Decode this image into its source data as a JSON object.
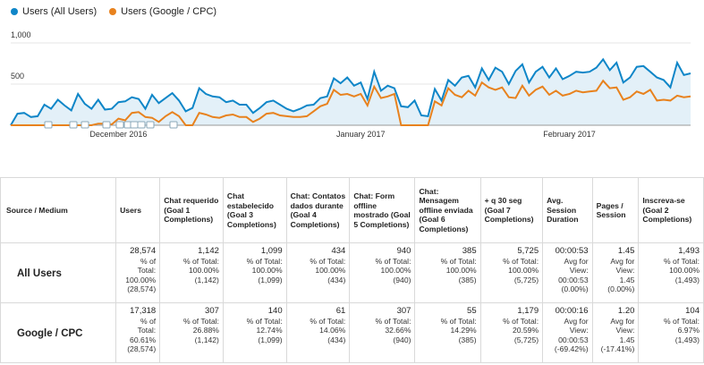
{
  "colors": {
    "all_users": "#0f86c8",
    "google_cpc": "#e8821e",
    "area_fill": "#e3f0f8",
    "grid": "#e5e5e5"
  },
  "legend": [
    {
      "label": "Users (All Users)",
      "color": "#0f86c8"
    },
    {
      "label": "Users (Google / CPC)",
      "color": "#e8821e"
    }
  ],
  "chart_data": {
    "type": "line",
    "ylim": [
      0,
      1000
    ],
    "yticks": [
      "1,000",
      "500"
    ],
    "x_labels": [
      "December 2016",
      "January 2017",
      "February 2017"
    ],
    "x": [
      "2016-11-19",
      "2016-11-20",
      "2016-11-21",
      "2016-11-22",
      "2016-11-23",
      "2016-11-24",
      "2016-11-25",
      "2016-11-26",
      "2016-11-27",
      "2016-11-28",
      "2016-11-29",
      "2016-11-30",
      "2016-12-01",
      "2016-12-02",
      "2016-12-03",
      "2016-12-04",
      "2016-12-05",
      "2016-12-06",
      "2016-12-07",
      "2016-12-08",
      "2016-12-09",
      "2016-12-10",
      "2016-12-11",
      "2016-12-12",
      "2016-12-13",
      "2016-12-14",
      "2016-12-15",
      "2016-12-16",
      "2016-12-17",
      "2016-12-18",
      "2016-12-19",
      "2016-12-20",
      "2016-12-21",
      "2016-12-22",
      "2016-12-23",
      "2016-12-24",
      "2016-12-25",
      "2016-12-26",
      "2016-12-27",
      "2016-12-28",
      "2016-12-29",
      "2016-12-30",
      "2016-12-31",
      "2017-01-01",
      "2017-01-02",
      "2017-01-03",
      "2017-01-04",
      "2017-01-05",
      "2017-01-06",
      "2017-01-07",
      "2017-01-08",
      "2017-01-09",
      "2017-01-10",
      "2017-01-11",
      "2017-01-12",
      "2017-01-13",
      "2017-01-14",
      "2017-01-15",
      "2017-01-16",
      "2017-01-17",
      "2017-01-18",
      "2017-01-19",
      "2017-01-20",
      "2017-01-21",
      "2017-01-22",
      "2017-01-23",
      "2017-01-24",
      "2017-01-25",
      "2017-01-26",
      "2017-01-27",
      "2017-01-28",
      "2017-01-29",
      "2017-01-30",
      "2017-01-31",
      "2017-02-01",
      "2017-02-02",
      "2017-02-03",
      "2017-02-04",
      "2017-02-05",
      "2017-02-06",
      "2017-02-07",
      "2017-02-08",
      "2017-02-09",
      "2017-02-10",
      "2017-02-11",
      "2017-02-12",
      "2017-02-13",
      "2017-02-14",
      "2017-02-15",
      "2017-02-16",
      "2017-02-17",
      "2017-02-18",
      "2017-02-19",
      "2017-02-20",
      "2017-02-21",
      "2017-02-22",
      "2017-02-23",
      "2017-02-24",
      "2017-02-25",
      "2017-02-26",
      "2017-02-27",
      "2017-02-28"
    ],
    "series": [
      {
        "name": "Users (All Users)",
        "values": [
          0,
          140,
          150,
          100,
          110,
          250,
          200,
          310,
          240,
          180,
          380,
          260,
          200,
          310,
          190,
          200,
          280,
          290,
          340,
          320,
          200,
          370,
          270,
          330,
          390,
          300,
          170,
          210,
          450,
          380,
          350,
          340,
          280,
          300,
          250,
          250,
          150,
          210,
          280,
          300,
          250,
          200,
          170,
          200,
          240,
          250,
          330,
          350,
          570,
          510,
          580,
          480,
          520,
          320,
          650,
          420,
          480,
          450,
          230,
          220,
          300,
          120,
          110,
          440,
          300,
          550,
          480,
          580,
          600,
          460,
          690,
          550,
          700,
          650,
          500,
          660,
          740,
          520,
          650,
          710,
          580,
          690,
          560,
          600,
          650,
          640,
          650,
          700,
          800,
          670,
          760,
          520,
          580,
          710,
          720,
          650,
          580,
          550,
          460,
          760,
          610,
          630
        ]
      },
      {
        "name": "Users (Google / CPC)",
        "values": [
          0,
          0,
          0,
          0,
          0,
          0,
          0,
          0,
          0,
          0,
          0,
          0,
          0,
          20,
          20,
          10,
          80,
          60,
          150,
          160,
          100,
          90,
          40,
          110,
          160,
          110,
          0,
          0,
          150,
          130,
          100,
          90,
          120,
          130,
          100,
          100,
          40,
          80,
          140,
          150,
          120,
          110,
          100,
          100,
          110,
          170,
          230,
          260,
          430,
          370,
          380,
          350,
          380,
          240,
          470,
          330,
          350,
          380,
          0,
          0,
          0,
          0,
          0,
          290,
          240,
          450,
          370,
          340,
          420,
          360,
          520,
          460,
          430,
          460,
          340,
          330,
          480,
          360,
          430,
          470,
          370,
          420,
          360,
          380,
          420,
          400,
          410,
          420,
          540,
          450,
          460,
          310,
          340,
          410,
          380,
          430,
          300,
          310,
          300,
          360,
          340,
          350
        ]
      }
    ]
  },
  "table": {
    "headers": [
      "Source / Medium",
      "Users",
      "Chat requerido (Goal 1 Completions)",
      "Chat estabelecido (Goal 3 Completions)",
      "Chat: Contatos dados durante (Goal 4 Completions)",
      "Chat: Form offline mostrado (Goal 5 Completions)",
      "Chat: Mensagem offline enviada (Goal 6 Completions)",
      "+ q 30 seg (Goal 7 Completions)",
      "Avg. Session Duration",
      "Pages / Session",
      "Inscreva-se (Goal 2 Completions)"
    ],
    "rows": [
      {
        "label": "All Users",
        "cells": [
          {
            "main": "28,574",
            "sub": [
              "% of",
              "Total:",
              "100.00%",
              "(28,574)"
            ]
          },
          {
            "main": "1,142",
            "sub": [
              "% of Total:",
              "100.00%",
              "(1,142)"
            ]
          },
          {
            "main": "1,099",
            "sub": [
              "% of Total:",
              "100.00%",
              "(1,099)"
            ]
          },
          {
            "main": "434",
            "sub": [
              "% of Total:",
              "100.00%",
              "(434)"
            ]
          },
          {
            "main": "940",
            "sub": [
              "% of Total:",
              "100.00%",
              "(940)"
            ]
          },
          {
            "main": "385",
            "sub": [
              "% of Total:",
              "100.00%",
              "(385)"
            ]
          },
          {
            "main": "5,725",
            "sub": [
              "% of Total:",
              "100.00%",
              "(5,725)"
            ]
          },
          {
            "main": "00:00:53",
            "sub": [
              "Avg for",
              "View:",
              "00:00:53",
              "(0.00%)"
            ]
          },
          {
            "main": "1.45",
            "sub": [
              "Avg for",
              "View:",
              "1.45",
              "(0.00%)"
            ]
          },
          {
            "main": "1,493",
            "sub": [
              "% of Total:",
              "100.00%",
              "(1,493)"
            ]
          }
        ]
      },
      {
        "label": "Google / CPC",
        "cells": [
          {
            "main": "17,318",
            "sub": [
              "% of",
              "Total:",
              "60.61%",
              "(28,574)"
            ]
          },
          {
            "main": "307",
            "sub": [
              "% of Total:",
              "26.88%",
              "(1,142)"
            ]
          },
          {
            "main": "140",
            "sub": [
              "% of Total:",
              "12.74%",
              "(1,099)"
            ]
          },
          {
            "main": "61",
            "sub": [
              "% of Total:",
              "14.06%",
              "(434)"
            ]
          },
          {
            "main": "307",
            "sub": [
              "% of Total:",
              "32.66%",
              "(940)"
            ]
          },
          {
            "main": "55",
            "sub": [
              "% of Total:",
              "14.29%",
              "(385)"
            ]
          },
          {
            "main": "1,179",
            "sub": [
              "% of Total:",
              "20.59%",
              "(5,725)"
            ]
          },
          {
            "main": "00:00:16",
            "sub": [
              "Avg for",
              "View:",
              "00:00:53",
              "(-69.42%)"
            ]
          },
          {
            "main": "1.20",
            "sub": [
              "Avg for",
              "View:",
              "1.45",
              "(-17.41%)"
            ]
          },
          {
            "main": "104",
            "sub": [
              "% of Total:",
              "6.97%",
              "(1,493)"
            ]
          }
        ]
      }
    ]
  }
}
